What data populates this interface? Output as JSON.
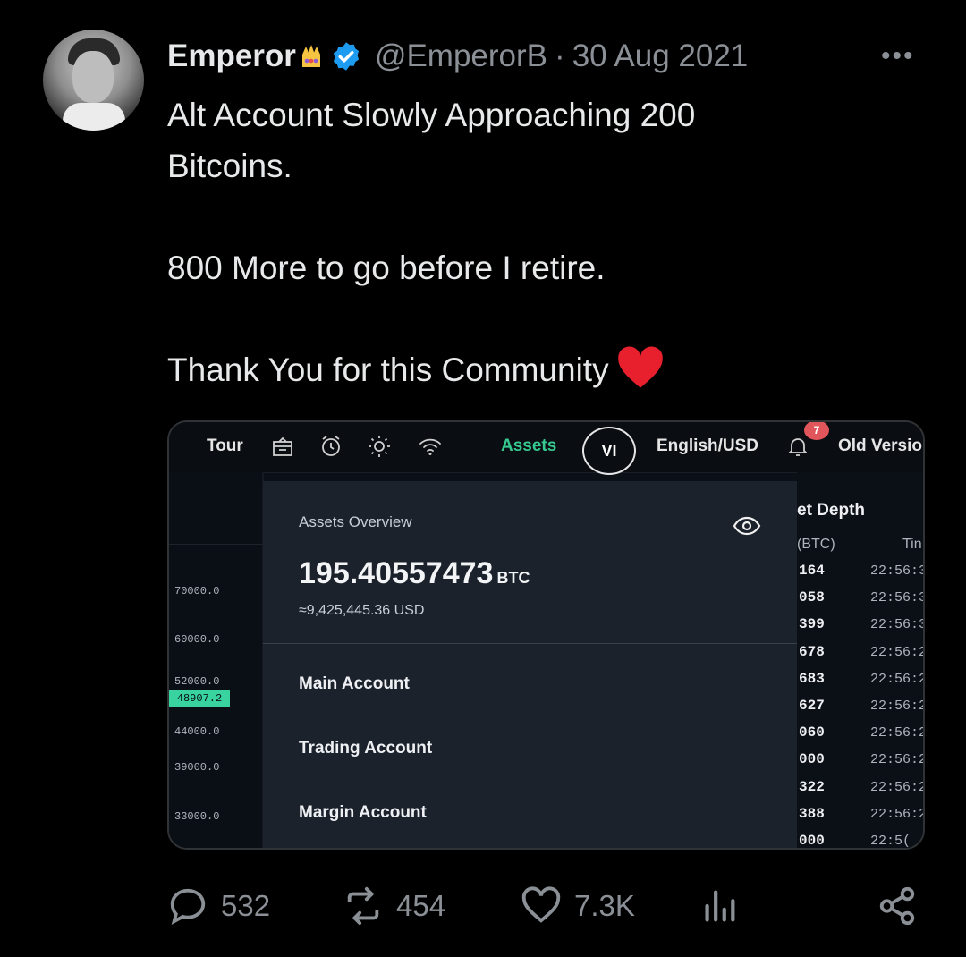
{
  "tweet": {
    "author_name": "Emperor",
    "handle": "@EmperorB",
    "separator": "·",
    "date": "30 Aug 2021",
    "more": "•••",
    "lines": [
      "Alt Account Slowly Approaching 200",
      "Bitcoins.",
      "800 More to go before I retire.",
      "Thank You for this Community"
    ]
  },
  "screenshot": {
    "topbar": {
      "tour": "Tour",
      "assets": "Assets",
      "vi": "VI",
      "language": "English/USD",
      "notification_count": "7",
      "old_version": "Old Versio"
    },
    "chart_ticks": [
      "70000.0",
      "60000.0",
      "52000.0",
      "44000.0",
      "39000.0",
      "33000.0"
    ],
    "price_tag": "48907.2",
    "assets_overview": {
      "title": "Assets Overview",
      "balance": "195.40557473",
      "balance_unit": "BTC",
      "usd_value": "≈9,425,445.36 USD",
      "accounts": [
        "Main Account",
        "Trading Account",
        "Margin Account"
      ]
    },
    "market_depth": {
      "title": "et Depth",
      "col1": "(BTC)",
      "col2": "Tin",
      "rows": [
        {
          "amount": "164",
          "time": "22:56:3"
        },
        {
          "amount": "058",
          "time": "22:56:3"
        },
        {
          "amount": "399",
          "time": "22:56:3"
        },
        {
          "amount": "678",
          "time": "22:56:2"
        },
        {
          "amount": "683",
          "time": "22:56:2"
        },
        {
          "amount": "627",
          "time": "22:56:2"
        },
        {
          "amount": "060",
          "time": "22:56:2"
        },
        {
          "amount": "000",
          "time": "22:56:2"
        },
        {
          "amount": "322",
          "time": "22:56:2"
        },
        {
          "amount": "388",
          "time": "22:56:2"
        },
        {
          "amount": "000",
          "time": "22:5("
        }
      ]
    }
  },
  "actions": {
    "replies": "532",
    "reposts": "454",
    "likes": "7.3K"
  },
  "colors": {
    "verified": "#1d9bf0",
    "heart": "#e8202e",
    "assets_green": "#36c98f",
    "price_tag": "#38d39f"
  }
}
